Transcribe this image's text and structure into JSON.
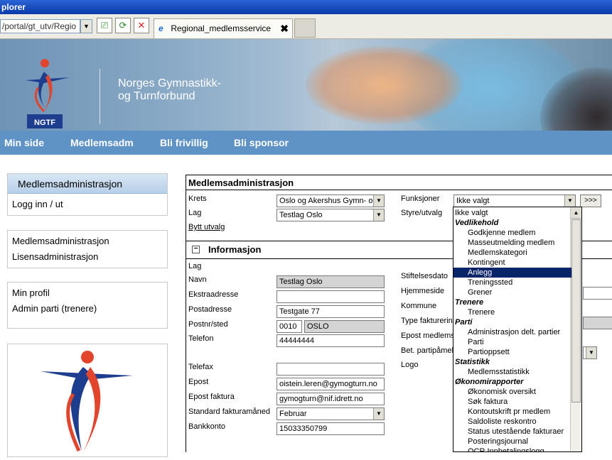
{
  "browser": {
    "title_fragment": "plorer",
    "address": "/portal/gt_utv/Regio",
    "tab_label": "Regional_medlemsservice",
    "tab_close": "✖"
  },
  "banner": {
    "org_line1": "Norges Gymnastikk-",
    "org_line2": "og Turnforbund",
    "logo_text": "NGTF"
  },
  "nav": [
    "Min side",
    "Medlemsadm",
    "Bli frivillig",
    "Bli sponsor"
  ],
  "sidebar": {
    "box1_title": "Medlemsadministrasjon",
    "box1_items": [
      "Logg inn / ut"
    ],
    "box2_items": [
      "Medlemsadministrasjon",
      "Lisensadministrasjon"
    ],
    "box3_items": [
      "Min profil",
      "Admin parti (trenere)"
    ]
  },
  "panel": {
    "title": "Medlemsadministrasjon",
    "krets_label": "Krets",
    "krets_value": "Oslo og Akershus Gymn- o",
    "lag_label": "Lag",
    "lag_value": "Testlag Oslo",
    "bytt_utvalg": "Bytt utvalg",
    "funksjoner_label": "Funksjoner",
    "funksjoner_value": "Ikke valgt",
    "go_button": ">>>",
    "styre_label": "Styre/utvalg"
  },
  "info": {
    "section_title": "Informasjon",
    "collapse_symbol": "−",
    "lag_label": "Lag",
    "navn_label": "Navn",
    "navn_value": "Testlag Oslo",
    "ekstra_label": "Ekstraadresse",
    "ekstra_value": "",
    "postadr_label": "Postadresse",
    "postadr_value": "Testgate 77",
    "postnr_label": "Postnr/sted",
    "postnr_value": "0010",
    "poststed_value": "OSLO",
    "telefon_label": "Telefon",
    "telefon_value": "44444444",
    "telefax_label": "Telefax",
    "telefax_value": "",
    "epost_label": "Epost",
    "epost_value": "oistein.leren@gymogturn.no",
    "epostfakt_label": "Epost faktura",
    "epostfakt_value": "gymogturn@nif.idrett.no",
    "fakturamnd_label": "Standard fakturamåned",
    "fakturamnd_value": "Februar",
    "bankkonto_label": "Bankkonto",
    "bankkonto_value": "15033350799",
    "stiftelse_label": "Stiftelsesdato",
    "hjemmeside_label": "Hjemmeside",
    "kommune_label": "Kommune",
    "typefakt_label": "Type fakturerin",
    "epostmedl_label": "Epost medlems",
    "betparti_label": "Bet. partipåmel",
    "logo_label": "Logo"
  },
  "dropdown": [
    {
      "text": "Ikke valgt",
      "kind": "plain"
    },
    {
      "text": "Vedlikehold",
      "kind": "hdr"
    },
    {
      "text": "Godkjenne medlem",
      "kind": "opt"
    },
    {
      "text": "Masseutmelding medlem",
      "kind": "opt"
    },
    {
      "text": "Medlemskategori",
      "kind": "opt"
    },
    {
      "text": "Kontingent",
      "kind": "opt"
    },
    {
      "text": "Anlegg",
      "kind": "opt",
      "selected": true
    },
    {
      "text": "Treningssted",
      "kind": "opt"
    },
    {
      "text": "Grener",
      "kind": "opt"
    },
    {
      "text": "Trenere",
      "kind": "hdr"
    },
    {
      "text": "Trenere",
      "kind": "opt"
    },
    {
      "text": "Parti",
      "kind": "hdr"
    },
    {
      "text": "Administrasjon delt. partier",
      "kind": "opt"
    },
    {
      "text": "Parti",
      "kind": "opt"
    },
    {
      "text": "Partioppsett",
      "kind": "opt"
    },
    {
      "text": "Statistikk",
      "kind": "hdr"
    },
    {
      "text": "Medlemsstatistikk",
      "kind": "opt"
    },
    {
      "text": "Økonomirapporter",
      "kind": "hdr"
    },
    {
      "text": "Økonomisk oversikt",
      "kind": "opt"
    },
    {
      "text": "Søk faktura",
      "kind": "opt"
    },
    {
      "text": "Kontoutskrift pr medlem",
      "kind": "opt"
    },
    {
      "text": "Saldoliste reskontro",
      "kind": "opt"
    },
    {
      "text": "Status utestående fakturaer",
      "kind": "opt"
    },
    {
      "text": "Posteringsjournal",
      "kind": "opt"
    },
    {
      "text": "OCR Innbetalingslogg",
      "kind": "opt"
    }
  ],
  "colors": {
    "nav_bg": "#5f93c5",
    "selected_bg": "#0a246a",
    "logo_blue": "#1d3d8f",
    "logo_red": "#e2452c"
  }
}
